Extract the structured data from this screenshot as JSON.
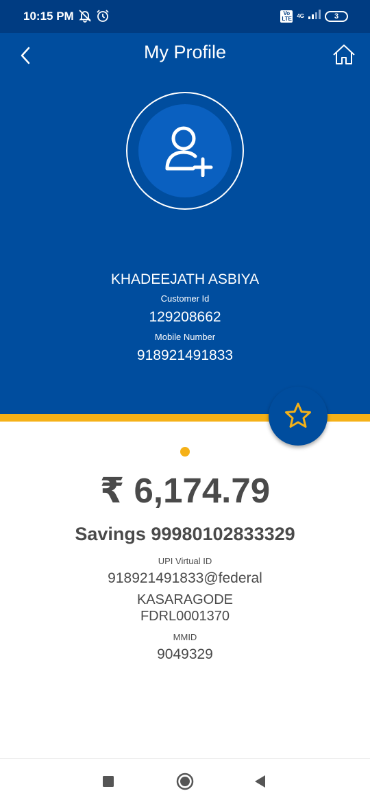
{
  "status_bar": {
    "time": "10:15 PM",
    "volte": "Vo LTE",
    "network": "4G",
    "battery": "3"
  },
  "header": {
    "title": "My Profile",
    "back_icon": "chevron-left-icon",
    "home_icon": "home-icon",
    "avatar_icon": "add-user-icon"
  },
  "profile": {
    "name": "KHADEEJATH ASBIYA",
    "customer_id_label": "Customer Id",
    "customer_id": "129208662",
    "mobile_label": "Mobile Number",
    "mobile": "918921491833"
  },
  "favorite_icon": "star-icon",
  "account": {
    "balance": "₹ 6,174.79",
    "title": "Savings 99980102833329",
    "upi_label": "UPI Virtual ID",
    "upi_id": "918921491833@federal",
    "branch": "KASARAGODE",
    "ifsc": "FDRL0001370",
    "mmid_label": "MMID",
    "mmid": "9049329"
  },
  "colors": {
    "primary": "#004d9e",
    "status_bar": "#003c82",
    "accent": "#f5b118",
    "text_dark": "#4a4a4a"
  },
  "nav_bar": {
    "recent_icon": "square-icon",
    "home_icon": "circle-home-icon",
    "back_icon": "triangle-back-icon"
  }
}
